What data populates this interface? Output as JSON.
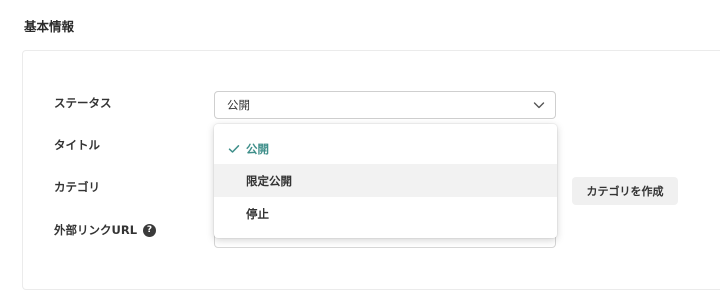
{
  "section": {
    "title": "基本情報"
  },
  "form": {
    "status_label": "ステータス",
    "title_label": "タイトル",
    "category_label": "カテゴリ",
    "external_link_label": "外部リンクURL",
    "help_icon_glyph": "?",
    "status_value": "公開",
    "create_category_label": "カテゴリを作成"
  },
  "dropdown": {
    "options": [
      {
        "label": "公開",
        "selected": true
      },
      {
        "label": "限定公開",
        "hovered": true
      },
      {
        "label": "停止"
      }
    ]
  },
  "colors": {
    "accent_selected": "#3f8f8a",
    "hover_bg": "#f2f2f2",
    "button_bg": "#f0f0f0"
  }
}
